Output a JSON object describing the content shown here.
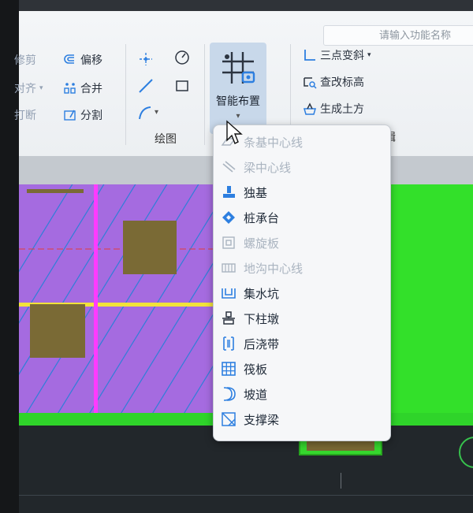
{
  "search": {
    "placeholder": "请输入功能名称"
  },
  "ribbon": {
    "modify_group": [
      {
        "label": "修剪",
        "icon": "trim-icon",
        "faded": true
      },
      {
        "label": "对齐",
        "icon": "align-icon",
        "faded": true,
        "has_arrow": true
      },
      {
        "label": "打断",
        "icon": "break-icon",
        "faded": true
      },
      {
        "label": "偏移",
        "icon": "offset-icon"
      },
      {
        "label": "合并",
        "icon": "merge-icon"
      },
      {
        "label": "分割",
        "icon": "split-icon"
      }
    ],
    "draw_group_label": "绘图",
    "smart_layout": {
      "label": "智能布置",
      "arrow": "▾"
    },
    "terrain_group": [
      {
        "label": "三点变斜",
        "icon": "three-point-slope-icon",
        "has_arrow": true
      },
      {
        "label": "查改标高",
        "icon": "check-elevation-icon"
      },
      {
        "label": "生成土方",
        "icon": "generate-earthwork-icon"
      }
    ],
    "partial_label": "辑"
  },
  "menu": {
    "items": [
      {
        "label": "条基中心线",
        "icon": "strip-foundation-centerline-icon",
        "enabled": false
      },
      {
        "label": "梁中心线",
        "icon": "beam-centerline-icon",
        "enabled": false
      },
      {
        "label": "独基",
        "icon": "isolated-footing-icon",
        "enabled": true
      },
      {
        "label": "桩承台",
        "icon": "pile-cap-icon",
        "enabled": true
      },
      {
        "label": "螺旋板",
        "icon": "spiral-plate-icon",
        "enabled": false
      },
      {
        "label": "地沟中心线",
        "icon": "trench-centerline-icon",
        "enabled": false
      },
      {
        "label": "集水坑",
        "icon": "sump-pit-icon",
        "enabled": true
      },
      {
        "label": "下柱墩",
        "icon": "column-pier-icon",
        "enabled": true
      },
      {
        "label": "后浇带",
        "icon": "post-cast-strip-icon",
        "enabled": true
      },
      {
        "label": "筏板",
        "icon": "raft-slab-icon",
        "enabled": true
      },
      {
        "label": "坡道",
        "icon": "ramp-icon",
        "enabled": true
      },
      {
        "label": "支撑梁",
        "icon": "support-beam-icon",
        "enabled": true
      }
    ]
  },
  "colors": {
    "slab": "#a56be0",
    "green": "#33e02a",
    "footing": "#7a6a35",
    "axis_yellow": "#f2e23a",
    "axis_magenta": "#ff3bff",
    "hatch": "#2f7fd8",
    "accent_blue": "#2d7fe0"
  }
}
